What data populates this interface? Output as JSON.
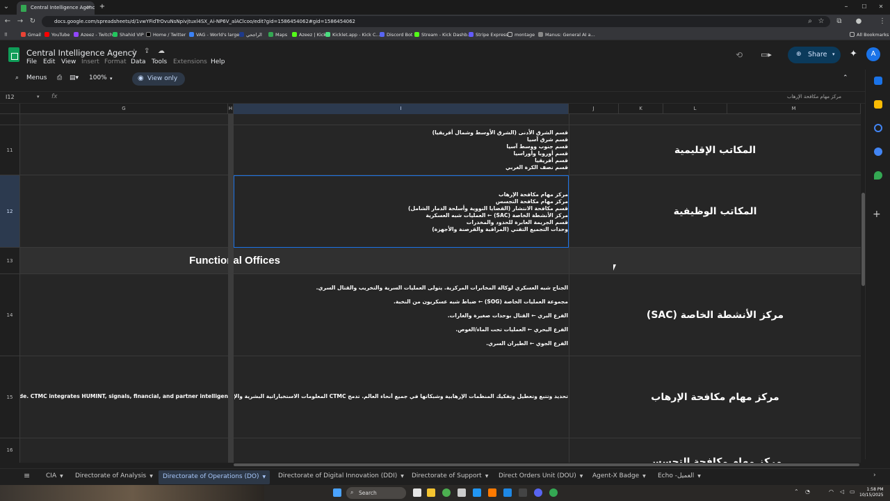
{
  "browser": {
    "tab_title": "Central Intelligence Agency - G",
    "url": "docs.google.com/spreadsheets/d/1vwYFidTrOvuNsNpivjtuxl4SX_Ai-NP6V_alAClcoo/edit?gid=1586454062#gid=1586454062",
    "bookmarks": [
      "Gmail",
      "YouTube",
      "Azeez - Twitch",
      "Shahid VIP",
      "Home / Twitter",
      "VAG - World's large...",
      "الراجحي",
      "Maps",
      "Azeez | Kick",
      "Kicklet.app - Kick C...",
      "Discord Bot",
      "Stream - Kick Dashb...",
      "Stripe Express",
      "montage",
      "Manus: General AI a..."
    ],
    "all_bookmarks": "All Bookmarks"
  },
  "sheets": {
    "doc_title": "Central Intelligence Agency",
    "menus": [
      "File",
      "Edit",
      "View",
      "Insert",
      "Format",
      "Data",
      "Tools",
      "Extensions",
      "Help"
    ],
    "toolbar": {
      "menus": "Menus",
      "zoom": "100%",
      "view_only": "View only"
    },
    "share_label": "Share",
    "avatar_letter": "A",
    "name_box": "I12",
    "formula": "مركز مهام مكافحة الإرهاب",
    "columns": [
      "G",
      "H",
      "I",
      "J",
      "K",
      "L",
      "M"
    ],
    "rows": {
      "r11": {
        "num": "11",
        "I": [
          "قسم الشرق الأدنى (الشرق الأوسط وشمال أفريقيا)",
          "قسم شرق آسيا",
          "قسم جنوب ووسط آسيا",
          "قسم أوروبا وأوراسيا",
          "قسم أفريقيا",
          "قسم نصف الكرة الغربي"
        ],
        "J": "المكاتب الإقليمية"
      },
      "r12": {
        "num": "12",
        "I": [
          "مركز مهام مكافحة الإرهاب",
          "مركز مهام مكافحة التجسس",
          "قسم مكافحة الانتشار (القضايا النووية وأسلحة الدمار الشامل)",
          "مركز الأنشطة الخاصة (SAC) ← العمليات شبه العسكرية",
          "قسم الجريمة العابرة للحدود والمخدرات",
          "وحدات التجميع التقني (المراقبة والقرصنة والأجهزة)"
        ],
        "J": "المكاتب الوظيفية"
      },
      "r13": {
        "num": "13",
        "title": "Functional Offices"
      },
      "r14": {
        "num": "14",
        "I": [
          "الجناح شبه العسكري لوكالة المخابرات المركزية. يتولى العمليات السرية والتخريب والقتال السري.",
          "مجموعة العمليات الخاصة (SOG) ← ضباط شبه عسكريون من النخبة.",
          "الفرع البري ← القتال بوحدات صغيرة والغارات.",
          "الفرع البحري ← العمليات تحت الماء/الغوص.",
          "الفرع الجوي ← الطيران السري."
        ],
        "J": "مركز الأنشطة الخاصة (SAC)"
      },
      "r15": {
        "num": "15",
        "G": "works worldwide. CTMC integrates HUMINT, signals, financial, and partner intelligen",
        "I": "تحديد وتتبع وتعطيل وتفكيك المنظمات الإرهابية وشبكاتها في جميع أنحاء العالم. تدمج CTMC المعلومات الاستخباراتية البشرية والإشارات",
        "J": "مركز مهام مكافحة الإرهاب"
      },
      "r16": {
        "num": "16",
        "J": "مركز مهام مكافحة التجسس"
      }
    }
  },
  "sheet_tabs": [
    "CIA",
    "Directorate of Analysis",
    "Directorate of Operations (DO)",
    "Directorate of Digital Innovation (DDI)",
    "Directorate of Support",
    "Direct Orders Unit (DOU)",
    "Agent-X Badge",
    "Echo -العميل"
  ],
  "active_tab_index": 2,
  "taskbar": {
    "search": "Search",
    "time": "1:58 PM",
    "date": "10/15/2025"
  },
  "colors": {
    "accent": "#1a73e8",
    "sheets_green": "#0f9d58",
    "cell_bg": "#262626"
  }
}
